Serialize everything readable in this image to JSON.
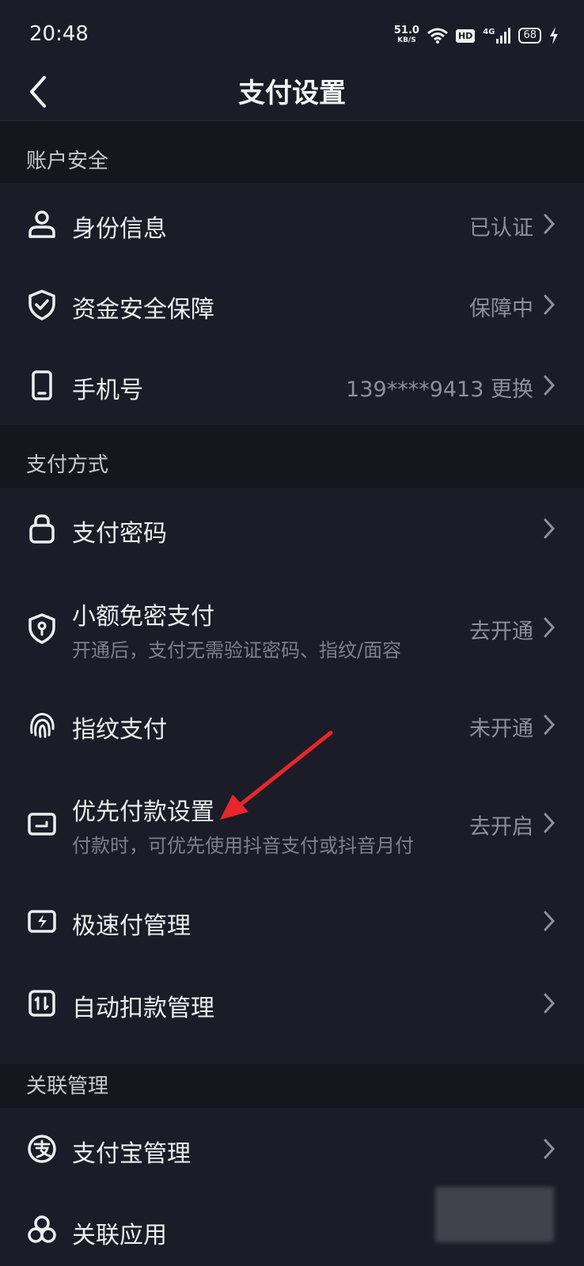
{
  "status": {
    "time": "20:48",
    "net_speed": "51.0",
    "net_unit": "KB/S",
    "hd": "HD",
    "network": "4G",
    "battery": "68"
  },
  "header": {
    "title": "支付设置"
  },
  "sections": {
    "account": {
      "label": "账户安全",
      "items": [
        {
          "label": "身份信息",
          "value": "已认证",
          "icon": "user-icon"
        },
        {
          "label": "资金安全保障",
          "value": "保障中",
          "icon": "shield-check-icon"
        },
        {
          "label": "手机号",
          "value": "139****9413 更换",
          "icon": "phone-icon"
        }
      ]
    },
    "payment": {
      "label": "支付方式",
      "items": [
        {
          "label": "支付密码",
          "value": "",
          "icon": "lock-icon"
        },
        {
          "label": "小额免密支付",
          "sub": "开通后，支付无需验证密码、指纹/面容",
          "value": "去开通",
          "icon": "shield-key-icon"
        },
        {
          "label": "指纹支付",
          "value": "未开通",
          "icon": "fingerprint-icon"
        },
        {
          "label": "优先付款设置",
          "sub": "付款时，可优先使用抖音支付或抖音月付",
          "value": "去开启",
          "icon": "wallet-icon"
        },
        {
          "label": "极速付管理",
          "value": "",
          "icon": "flash-pay-icon"
        },
        {
          "label": "自动扣款管理",
          "value": "",
          "icon": "auto-debit-icon"
        }
      ]
    },
    "linked": {
      "label": "关联管理",
      "items": [
        {
          "label": "支付宝管理",
          "value": "",
          "icon": "alipay-icon"
        },
        {
          "label": "关联应用",
          "value": "",
          "icon": "linked-apps-icon"
        }
      ]
    }
  },
  "colors": {
    "background": "#16161e",
    "panel": "#1b1c27",
    "annotation_arrow": "#e8262b"
  }
}
